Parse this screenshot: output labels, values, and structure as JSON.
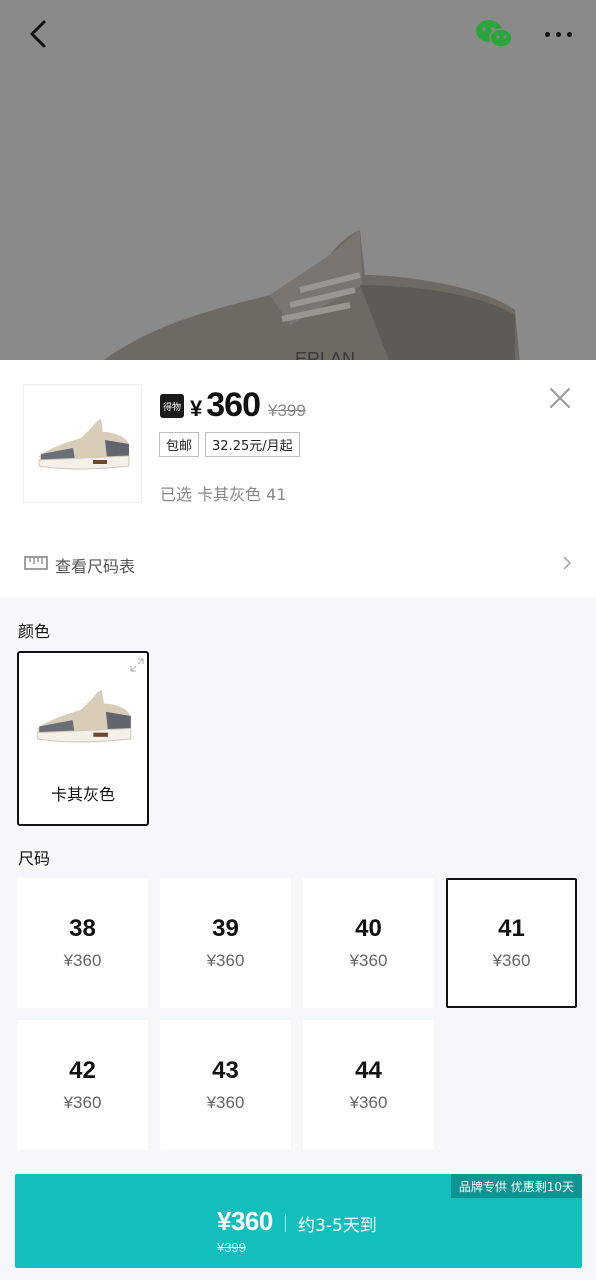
{
  "background": {
    "icons": {
      "back": "chevron-left-icon",
      "share": "wechat-icon",
      "more": "more-icon"
    }
  },
  "product": {
    "brand_badge": "得物",
    "currency": "¥",
    "price": "360",
    "original_price": "¥399",
    "tags": [
      "包邮",
      "32.25元/月起"
    ],
    "selected_text": "已选 卡其灰色 41",
    "size_chart_label": "查看尺码表"
  },
  "options": {
    "color_section_label": "颜色",
    "colors": [
      {
        "name": "卡其灰色",
        "selected": true
      }
    ],
    "size_section_label": "尺码",
    "sizes": [
      {
        "size": "38",
        "price": "¥360",
        "selected": false
      },
      {
        "size": "39",
        "price": "¥360",
        "selected": false
      },
      {
        "size": "40",
        "price": "¥360",
        "selected": false
      },
      {
        "size": "41",
        "price": "¥360",
        "selected": true
      },
      {
        "size": "42",
        "price": "¥360",
        "selected": false
      },
      {
        "size": "43",
        "price": "¥360",
        "selected": false
      },
      {
        "size": "44",
        "price": "¥360",
        "selected": false
      }
    ]
  },
  "buy_button": {
    "badge": "品牌专供 优惠剩10天",
    "price": "¥360",
    "delivery": "约3-5天到",
    "original_price": "¥399"
  },
  "colors": {
    "accent": "#12bfbc",
    "selected_border": "#111111",
    "options_bg": "#f6f7fb"
  }
}
